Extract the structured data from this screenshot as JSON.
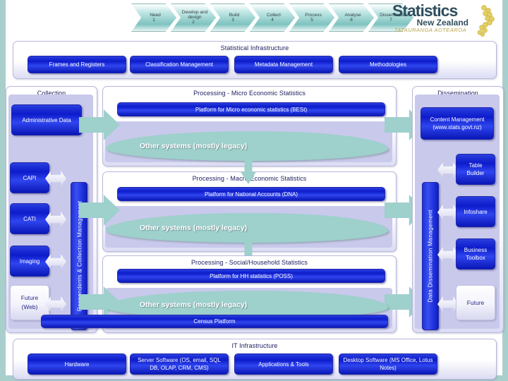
{
  "lifecycle": {
    "steps": [
      {
        "label": "Need",
        "num": "1"
      },
      {
        "label": "Develop and design",
        "num": "2"
      },
      {
        "label": "Build",
        "num": "3"
      },
      {
        "label": "Collect",
        "num": "4"
      },
      {
        "label": "Process",
        "num": "5"
      },
      {
        "label": "Analyse",
        "num": "6"
      },
      {
        "label": "Disseminate",
        "num": "7"
      }
    ]
  },
  "logo": {
    "line1": "Statistics",
    "line2": "New Zealand",
    "line3": "TATAURANGA AOTEAROA"
  },
  "statistical_infrastructure": {
    "title": "Statistical Infrastructure",
    "boxes": [
      "Frames and Registers",
      "Classification Management",
      "Metadata Management",
      "Methodologies"
    ]
  },
  "collection": {
    "title": "Collection",
    "admin_data": "Administrative Data",
    "rail_label": "Respondents & Collection Management",
    "items": [
      "CAPI",
      "CATI",
      "Imaging"
    ],
    "future": {
      "line1": "Future",
      "line2": "(Web)"
    }
  },
  "processing": {
    "micro": {
      "title": "Processing -  Micro Economic Statistics",
      "platform": "Platform for Micro economic statistics (BESt)",
      "legacy": "Other systems (mostly legacy)"
    },
    "macro": {
      "title": "Processing -  Macro Economic Statistics",
      "platform": "Platform for National Accounts (DNA)",
      "legacy": "Other systems (mostly legacy)"
    },
    "social": {
      "title": "Processing -  Social/Household Statistics",
      "platform": "Platform for HH statistics (POSS)",
      "legacy": "Other systems (mostly legacy)",
      "census": "Census Platform"
    }
  },
  "dissemination": {
    "title": "Dissemination",
    "content_management": {
      "line1": "Content Management",
      "line2": "(www.stats.govt.nz)"
    },
    "rail_label": "Data Dissemination Management",
    "items": [
      {
        "line1": "Table",
        "line2": "Builder"
      },
      {
        "line1": "Infoshare",
        "line2": ""
      },
      {
        "line1": "Business",
        "line2": "Toolbox"
      }
    ],
    "future": "Future"
  },
  "it_infrastructure": {
    "title": "IT Infrastructure",
    "boxes": [
      "Hardware",
      "Server Software (OS, email, SQL DB, OLAP, CRM, CMS)",
      "Applications & Tools",
      "Desktop Software (MS Office, Lotus Notes)"
    ]
  },
  "colors": {
    "blue": "#1526cf",
    "teal": "#9ed0cc",
    "lavender": "#c9c9ec",
    "panel_border": "#b9b9dd",
    "title_text": "#1b1b5e"
  }
}
